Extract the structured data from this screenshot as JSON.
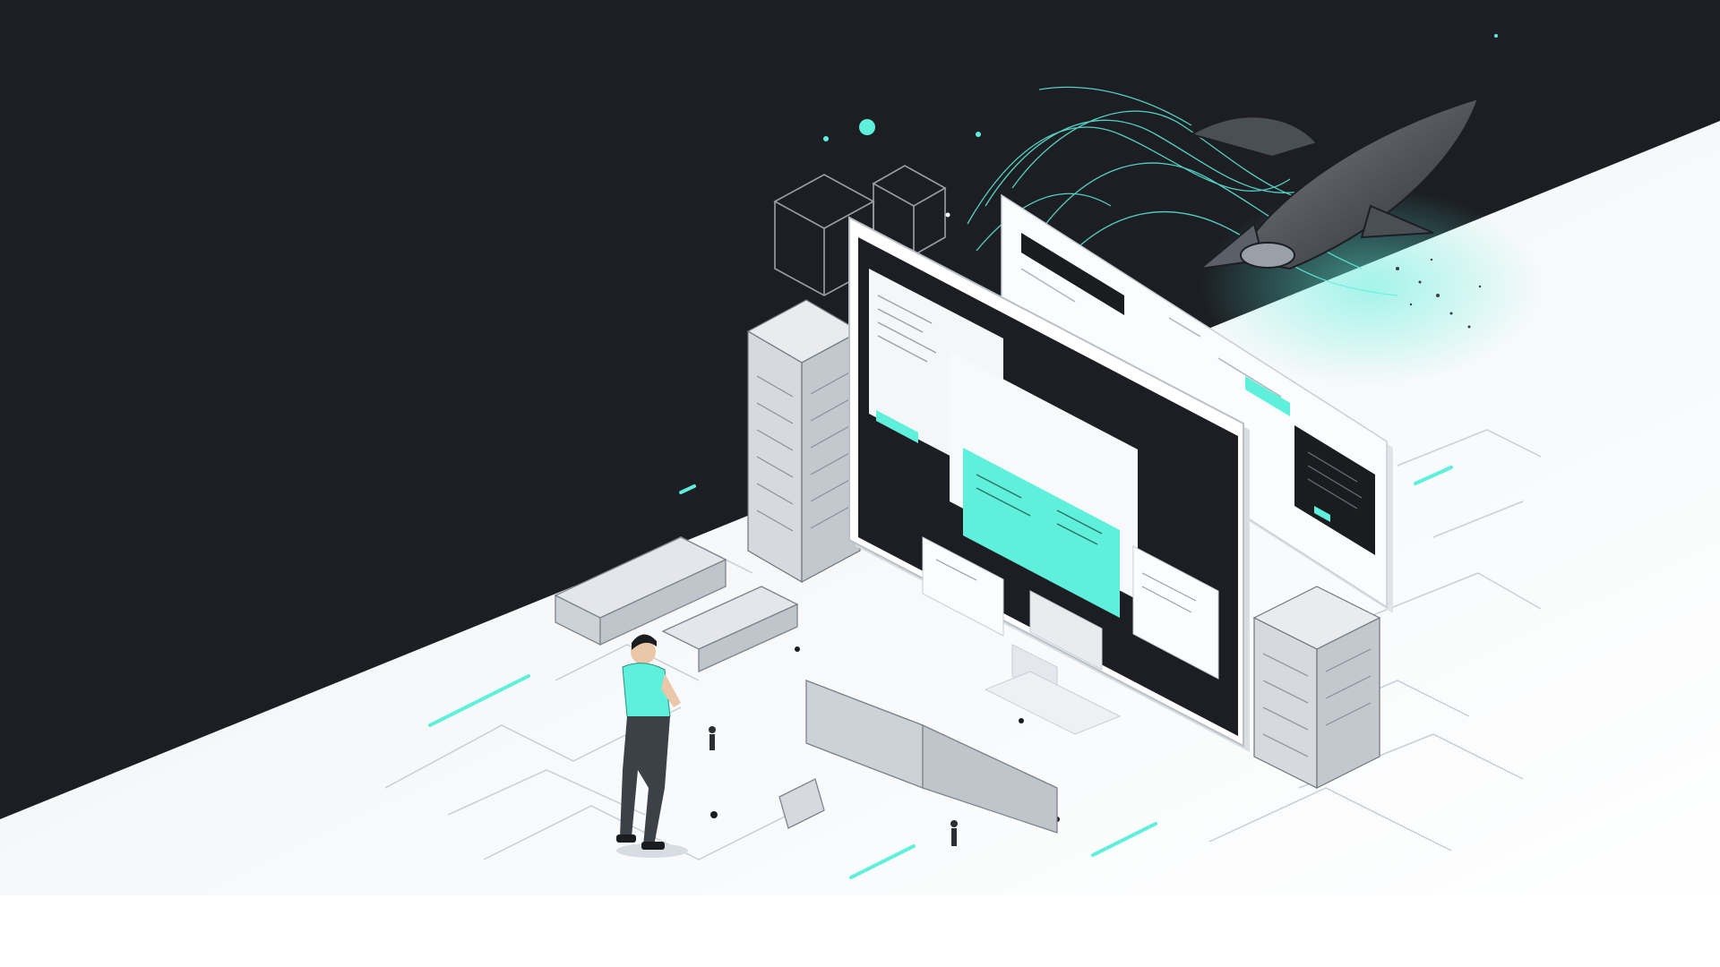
{
  "scene": {
    "kind": "isometric website illustration",
    "colors": {
      "dark_background": "#1c1e24",
      "light_floor": "#f3f6f8",
      "accent": "#5ff0dc",
      "panel_white": "#fbfcfd",
      "ink": "#1a1c20",
      "line_gray": "#b9c0c6"
    },
    "icons": [
      "person-figure",
      "spaceship",
      "wireframe-cube",
      "server-tower",
      "machinery"
    ]
  }
}
